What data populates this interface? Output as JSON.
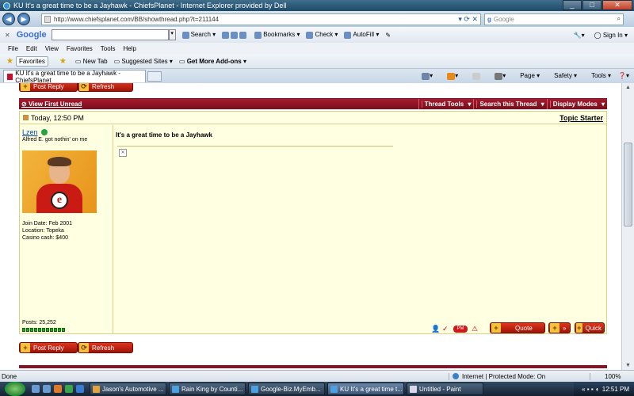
{
  "window": {
    "title": "KU It's a great time to be a Jayhawk - ChiefsPlanet - Internet Explorer provided by Dell",
    "url": "http://www.chiefsplanet.com/BB/showthread.php?t=211144",
    "search_placeholder": "Google"
  },
  "google_toolbar": {
    "logo": "Google",
    "search": "Search",
    "bookmarks": "Bookmarks",
    "check": "Check",
    "autofill": "AutoFill",
    "sign_in": "Sign In"
  },
  "menu": [
    "File",
    "Edit",
    "View",
    "Favorites",
    "Tools",
    "Help"
  ],
  "favorites_bar": {
    "favorites": "Favorites",
    "new_tab": "New Tab",
    "suggested": "Suggested Sites",
    "addons": "Get More Add-ons"
  },
  "tab": {
    "label": "KU It's a great time to be a Jayhawk - ChiefsPlanet"
  },
  "command_bar": {
    "page": "Page",
    "safety": "Safety",
    "tools": "Tools"
  },
  "page": {
    "post_reply_label": "Post Reply",
    "refresh_label": "Refresh",
    "view_first_unread": "View First Unread",
    "thread_tools": "Thread Tools",
    "search_thread": "Search this Thread",
    "display_modes": "Display Modes",
    "post_date": "Today, 12:50 PM",
    "topic_starter": "Topic Starter",
    "post_title": "It's a great time to be a Jayhawk",
    "quote_label": "Quote",
    "quick_label": "Quick",
    "user": {
      "name": "Lzen",
      "title": "Alfred E. got nothin' on me",
      "join_date": "Join Date: Feb 2001",
      "location": "Location: Topeka",
      "casino_cash": "Casino cash: $400",
      "posts": "Posts: 25,252",
      "reputation_pips": 11
    }
  },
  "status": {
    "left": "Done",
    "zone": "Internet | Protected Mode: On",
    "zoom": "100%"
  },
  "taskbar": {
    "tasks": [
      "Jason's Automotive ...",
      "Rain King by Counti...",
      "Google-Biz.MyEmb...",
      "KU It's a great time t...",
      "Untitled - Paint"
    ],
    "clock": "12:51 PM"
  },
  "colors": {
    "thread_bar": "#8b1424",
    "post_bg": "#ffffe1",
    "button_red": "#c21d10"
  }
}
